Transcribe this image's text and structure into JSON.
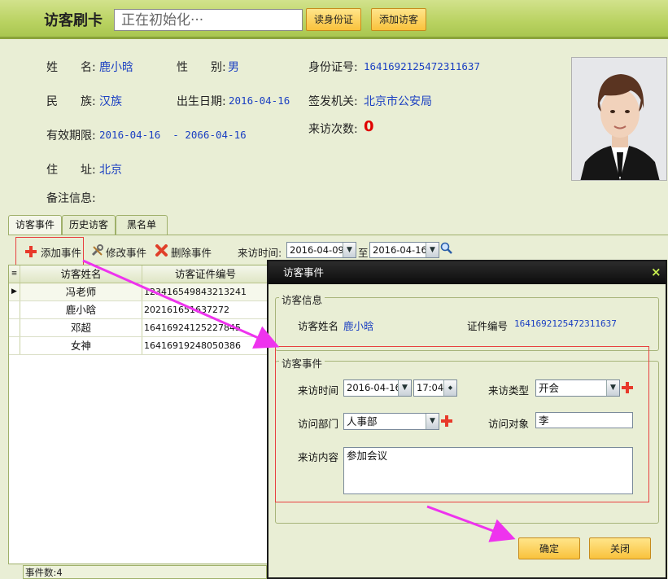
{
  "header": {
    "title": "访客刷卡",
    "status_text": "正在初始化···",
    "read_id_button": "读身份证",
    "add_visitor_button": "添加访客"
  },
  "visitor": {
    "name_label": "姓　　名:",
    "name": "鹿小晗",
    "gender_label": "性　　别:",
    "gender": "男",
    "id_label": "身份证号:",
    "id_number": "1641692125472311637",
    "ethnicity_label": "民　　族:",
    "ethnicity": "汉族",
    "birth_label": "出生日期:",
    "birth_date": "2016-04-16",
    "authority_label": "签发机关:",
    "authority": "北京市公安局",
    "validity_label": "有效期限:",
    "validity": "2016-04-16  - 2066-04-16",
    "visit_count_label": "来访次数:",
    "visit_count": "0",
    "address_label": "住　　址:",
    "address": "北京",
    "remark_label": "备注信息:"
  },
  "tabs": [
    "访客事件",
    "历史访客",
    "黑名单"
  ],
  "toolbar": {
    "add_event": "添加事件",
    "edit_event": "修改事件",
    "delete_event": "删除事件",
    "visit_time_label": "来访时间:",
    "date_from": "2016-04-09",
    "to_label": "至",
    "date_to": "2016-04-16"
  },
  "table": {
    "columns": [
      "访客姓名",
      "访客证件编号"
    ],
    "rows": [
      {
        "name": "冯老师",
        "id": "123416549843213241"
      },
      {
        "name": "鹿小晗",
        "id": "202161651637272"
      },
      {
        "name": "邓超",
        "id": "16416924125227845"
      },
      {
        "name": "女神",
        "id": "16416919248050386"
      }
    ]
  },
  "status": {
    "event_count": "事件数:4"
  },
  "dialog": {
    "title": "访客事件",
    "close_glyph": "×",
    "info_legend": "访客信息",
    "visitor_name_label": "访客姓名",
    "visitor_name": "鹿小晗",
    "cert_label": "证件编号",
    "cert_number": "1641692125472311637",
    "event_legend": "访客事件",
    "visit_time_label": "来访时间",
    "visit_date": "2016-04-16",
    "visit_time": "17:04",
    "visit_type_label": "来访类型",
    "visit_type": "开会",
    "dept_label": "访问部门",
    "dept": "人事部",
    "target_label": "访问对象",
    "target": "李",
    "content_label": "来访内容",
    "content": "参加会议",
    "ok_button": "确定",
    "close_button": "关闭"
  },
  "colors": {
    "accent_blue": "#1a3fc2",
    "count_red": "#e00000",
    "arrow_magenta": "#ee33ee",
    "highlight_red": "#e84040"
  }
}
